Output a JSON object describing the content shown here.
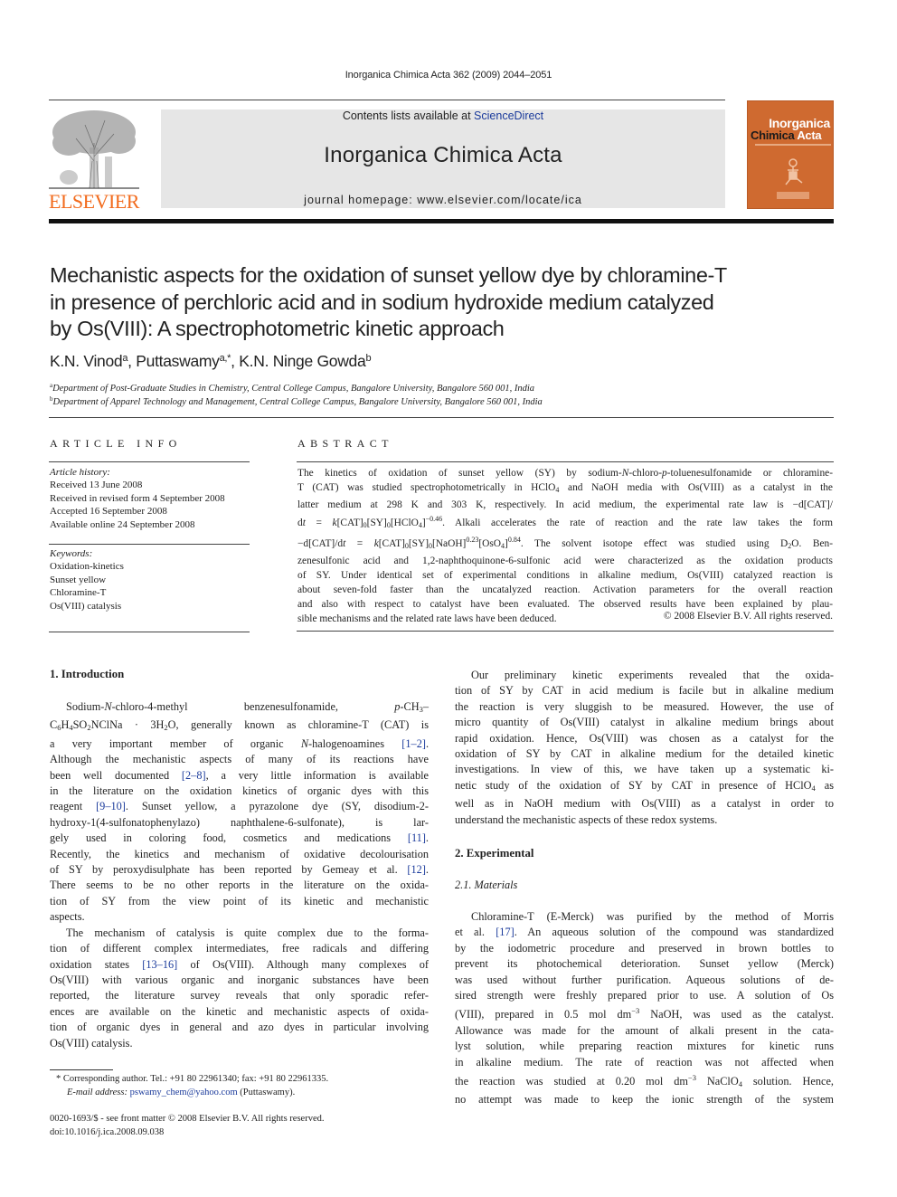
{
  "running_header": "Inorganica Chimica Acta 362 (2009) 2044–2051",
  "masthead": {
    "publisher_logo_text": "ELSEVIER",
    "contents_prefix": "Contents lists available at ",
    "contents_link": "ScienceDirect",
    "journal_name": "Inorganica Chimica Acta",
    "homepage": "journal homepage: www.elsevier.com/locate/ica",
    "cover": {
      "title_line1": "Inorganica",
      "title_line2_a": "Chimica",
      "title_line2_b": "Acta",
      "bg_color": "#cf6a30"
    },
    "colors": {
      "elsevier_orange": "#f26b1d",
      "link_blue": "#1a3a9b",
      "masthead_bg": "#e6e6e6"
    }
  },
  "article": {
    "title_lines": [
      "Mechanistic aspects for the oxidation of sunset yellow dye by chloramine-T",
      "in presence of perchloric acid and in sodium hydroxide medium catalyzed",
      "by Os(VIII): A spectrophotometric kinetic approach"
    ],
    "authors": [
      {
        "name": "K.N. Vinod",
        "sup": "a"
      },
      {
        "name": "Puttaswamy",
        "sup": "a,*"
      },
      {
        "name": "K.N. Ninge Gowda",
        "sup": "b"
      }
    ],
    "affiliations": [
      {
        "sup": "a",
        "text": "Department of Post-Graduate Studies in Chemistry, Central College Campus, Bangalore University, Bangalore 560 001, India"
      },
      {
        "sup": "b",
        "text": "Department of Apparel Technology and Management, Central College Campus, Bangalore University, Bangalore 560 001, India"
      }
    ]
  },
  "article_info": {
    "heading": "ARTICLE INFO",
    "history_label": "Article history:",
    "history": [
      "Received 13 June 2008",
      "Received in revised form 4 September 2008",
      "Accepted 16 September 2008",
      "Available online 24 September 2008"
    ],
    "keywords_label": "Keywords:",
    "keywords": [
      "Oxidation-kinetics",
      "Sunset yellow",
      "Chloramine-T",
      "Os(VIII) catalysis"
    ]
  },
  "abstract": {
    "heading": "ABSTRACT",
    "lines": [
      "The kinetics of oxidation of sunset yellow (SY) by sodium-<i>N</i>-chloro-<i>p</i>-toluenesulfonamide or chloramine-",
      "T (CAT) was studied spectrophotometrically in HClO<sub>4</sub> and NaOH media with Os(VIII) as a catalyst in the",
      "latter medium at 298 K and 303 K, respectively. In acid medium, the experimental rate law is −d[CAT]/",
      "d<i>t</i> = <i>k</i>[CAT]<sub>0</sub>[SY]<sub>0</sub>[HClO<sub>4</sub>]<sup>−0.46</sup>. Alkali accelerates the rate of reaction and the rate law takes the form",
      "−d[CAT]/d<i>t</i> = <i>k</i>[CAT]<sub>0</sub>[SY]<sub>0</sub>[NaOH]<sup>0.23</sup>[OsO<sub>4</sub>]<sup>0.84</sup>. The solvent isotope effect was studied using D<sub>2</sub>O. Ben-",
      "zenesulfonic acid and 1,2-naphthoquinone-6-sulfonic acid were characterized as the oxidation products",
      "of SY. Under identical set of experimental conditions in alkaline medium, Os(VIII) catalyzed reaction is",
      "about seven-fold faster than the uncatalyzed reaction. Activation parameters for the overall reaction",
      "and also with respect to catalyst have been evaluated. The observed results have been explained by plau-",
      "sible mechanisms and the related rate laws have been deduced."
    ],
    "copyright": "© 2008 Elsevier B.V. All rights reserved."
  },
  "body": {
    "intro_heading": "1. Introduction",
    "intro_lines": [
      {
        "t": "Sodium-<i>N</i>-chloro-4-methyl benzenesulfonamide, <i>p</i>-CH<sub>3</sub>–",
        "ind": true
      },
      {
        "t": "C<sub>6</sub>H<sub>4</sub>SO<sub>2</sub>NClNa · 3H<sub>2</sub>O, generally known as chloramine-T (CAT) is"
      },
      {
        "t": "a very important member of organic <i>N</i>-halogenoamines <span class=\"ref\">[1–2]</span>."
      },
      {
        "t": "Although the mechanistic aspects of many of its reactions have"
      },
      {
        "t": "been well documented <span class=\"ref\">[2–8]</span>, a very little information is available"
      },
      {
        "t": "in the literature on the oxidation kinetics of organic dyes with this"
      },
      {
        "t": "reagent <span class=\"ref\">[9–10]</span>. Sunset yellow, a pyrazolone dye (SY, disodium-2-"
      },
      {
        "t": "hydroxy-1(4-sulfonatophenylazo) naphthalene-6-sulfonate), is lar-"
      },
      {
        "t": "gely used in coloring food, cosmetics and medications <span class=\"ref\">[11]</span>."
      },
      {
        "t": "Recently, the kinetics and mechanism of oxidative decolourisation"
      },
      {
        "t": "of SY by peroxydisulphate has been reported by Gemeay et al. <span class=\"ref\">[12]</span>."
      },
      {
        "t": "There seems to be no other reports in the literature on the oxida-"
      },
      {
        "t": "tion of SY from the view point of its kinetic and mechanistic"
      },
      {
        "t": "aspects.",
        "last": true
      },
      {
        "t": "The mechanism of catalysis is quite complex due to the forma-",
        "ind": true
      },
      {
        "t": "tion of different complex intermediates, free radicals and differing"
      },
      {
        "t": "oxidation states <span class=\"ref\">[13–16]</span> of Os(VIII). Although many complexes of"
      },
      {
        "t": "Os(VIII) with various organic and inorganic substances have been"
      },
      {
        "t": "reported, the literature survey reveals that only sporadic refer-"
      },
      {
        "t": "ences are available on the kinetic and mechanistic aspects of oxida-"
      },
      {
        "t": "tion of organic dyes in general and azo dyes in particular involving"
      },
      {
        "t": "Os(VIII) catalysis.",
        "last": true
      }
    ],
    "right_para1_lines": [
      {
        "t": "Our preliminary kinetic experiments revealed that the oxida-",
        "ind": true
      },
      {
        "t": "tion of SY by CAT in acid medium is facile but in alkaline medium"
      },
      {
        "t": "the reaction is very sluggish to be measured. However, the use of"
      },
      {
        "t": "micro quantity of Os(VIII) catalyst in alkaline medium brings about"
      },
      {
        "t": "rapid oxidation. Hence, Os(VIII) was chosen as a catalyst for the"
      },
      {
        "t": "oxidation of SY by CAT in alkaline medium for the detailed kinetic"
      },
      {
        "t": "investigations. In view of this, we have taken up a systematic ki-"
      },
      {
        "t": "netic study of the oxidation of SY by CAT in presence of HClO<sub>4</sub> as"
      },
      {
        "t": "well as in NaOH medium with Os(VIII) as a catalyst in order to"
      },
      {
        "t": "understand the mechanistic aspects of these redox systems.",
        "last": true
      }
    ],
    "experimental_heading": "2. Experimental",
    "materials_heading": "2.1. Materials",
    "materials_lines": [
      {
        "t": "Chloramine-T (E-Merck) was purified by the method of Morris",
        "ind": true
      },
      {
        "t": "et al. <span class=\"ref\">[17]</span>. An aqueous solution of the compound was standardized"
      },
      {
        "t": "by the iodometric procedure and preserved in brown bottles to"
      },
      {
        "t": "prevent its photochemical deterioration. Sunset yellow (Merck)"
      },
      {
        "t": "was used without further purification. Aqueous solutions of de-"
      },
      {
        "t": "sired strength were freshly prepared prior to use. A solution of Os"
      },
      {
        "t": "(VIII), prepared in 0.5 mol dm<sup>−3</sup> NaOH, was used as the catalyst."
      },
      {
        "t": "Allowance was made for the amount of alkali present in the cata-"
      },
      {
        "t": "lyst solution, while preparing reaction mixtures for kinetic runs"
      },
      {
        "t": "in alkaline medium. The rate of reaction was not affected when"
      },
      {
        "t": "the reaction was studied at 0.20 mol dm<sup>−3</sup> NaClO<sub>4</sub> solution. Hence,"
      },
      {
        "t": "no attempt was made to keep the ionic strength of the system"
      }
    ]
  },
  "footnote": {
    "corresponding": "* Corresponding author. Tel.: +91 80 22961340; fax: +91 80 22961335.",
    "email_label": "E-mail address:",
    "email": "pswamy_chem@yahoo.com",
    "email_suffix": " (Puttaswamy).",
    "issn_line": "0020-1693/$ - see front matter © 2008 Elsevier B.V. All rights reserved.",
    "doi": "doi:10.1016/j.ica.2008.09.038"
  }
}
